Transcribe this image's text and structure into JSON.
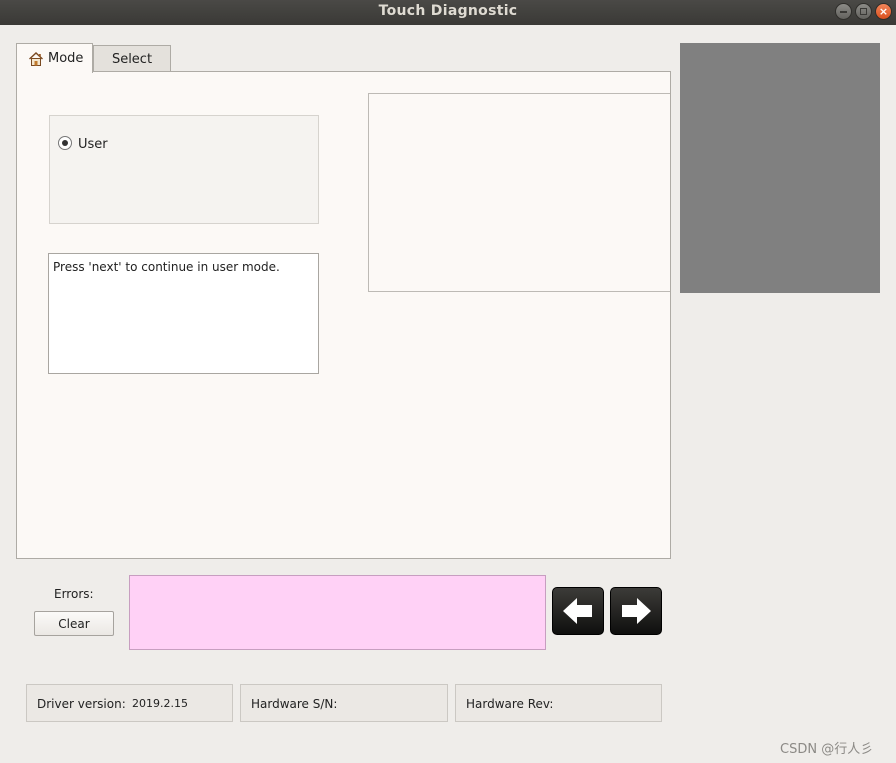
{
  "window": {
    "title": "Touch Diagnostic",
    "controls": [
      "minimize-icon",
      "maximize-icon",
      "close-icon"
    ],
    "close_glyph": "×"
  },
  "tabs": [
    {
      "label": "Mode",
      "icon": "house-icon",
      "active": true
    },
    {
      "label": "Select",
      "active": false
    }
  ],
  "mode": {
    "radio_label": "User",
    "radio_selected": true
  },
  "info_text": "Press 'next' to continue in user mode.",
  "errors": {
    "label": "Errors:",
    "clear_label": "Clear",
    "value": ""
  },
  "navigation": {
    "prev_icon": "arrow-left-icon",
    "next_icon": "arrow-right-icon"
  },
  "status": {
    "driver_label": "Driver version:",
    "driver_value": "2019.2.15",
    "sn_label": "Hardware S/N:",
    "sn_value": "",
    "rev_label": "Hardware Rev:",
    "rev_value": ""
  },
  "watermark": "CSDN @行人彡",
  "colors": {
    "error_box": "#ffd1f6",
    "preview_box": "#808080",
    "panel": "#fcf9f6"
  }
}
